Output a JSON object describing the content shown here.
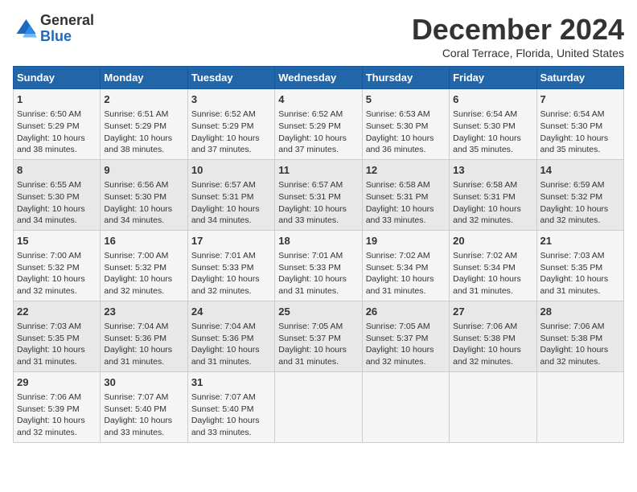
{
  "header": {
    "logo_line1": "General",
    "logo_line2": "Blue",
    "title": "December 2024",
    "subtitle": "Coral Terrace, Florida, United States"
  },
  "days_of_week": [
    "Sunday",
    "Monday",
    "Tuesday",
    "Wednesday",
    "Thursday",
    "Friday",
    "Saturday"
  ],
  "weeks": [
    [
      {
        "day": 1,
        "info": "Sunrise: 6:50 AM\nSunset: 5:29 PM\nDaylight: 10 hours\nand 38 minutes."
      },
      {
        "day": 2,
        "info": "Sunrise: 6:51 AM\nSunset: 5:29 PM\nDaylight: 10 hours\nand 38 minutes."
      },
      {
        "day": 3,
        "info": "Sunrise: 6:52 AM\nSunset: 5:29 PM\nDaylight: 10 hours\nand 37 minutes."
      },
      {
        "day": 4,
        "info": "Sunrise: 6:52 AM\nSunset: 5:29 PM\nDaylight: 10 hours\nand 37 minutes."
      },
      {
        "day": 5,
        "info": "Sunrise: 6:53 AM\nSunset: 5:30 PM\nDaylight: 10 hours\nand 36 minutes."
      },
      {
        "day": 6,
        "info": "Sunrise: 6:54 AM\nSunset: 5:30 PM\nDaylight: 10 hours\nand 35 minutes."
      },
      {
        "day": 7,
        "info": "Sunrise: 6:54 AM\nSunset: 5:30 PM\nDaylight: 10 hours\nand 35 minutes."
      }
    ],
    [
      {
        "day": 8,
        "info": "Sunrise: 6:55 AM\nSunset: 5:30 PM\nDaylight: 10 hours\nand 34 minutes."
      },
      {
        "day": 9,
        "info": "Sunrise: 6:56 AM\nSunset: 5:30 PM\nDaylight: 10 hours\nand 34 minutes."
      },
      {
        "day": 10,
        "info": "Sunrise: 6:57 AM\nSunset: 5:31 PM\nDaylight: 10 hours\nand 34 minutes."
      },
      {
        "day": 11,
        "info": "Sunrise: 6:57 AM\nSunset: 5:31 PM\nDaylight: 10 hours\nand 33 minutes."
      },
      {
        "day": 12,
        "info": "Sunrise: 6:58 AM\nSunset: 5:31 PM\nDaylight: 10 hours\nand 33 minutes."
      },
      {
        "day": 13,
        "info": "Sunrise: 6:58 AM\nSunset: 5:31 PM\nDaylight: 10 hours\nand 32 minutes."
      },
      {
        "day": 14,
        "info": "Sunrise: 6:59 AM\nSunset: 5:32 PM\nDaylight: 10 hours\nand 32 minutes."
      }
    ],
    [
      {
        "day": 15,
        "info": "Sunrise: 7:00 AM\nSunset: 5:32 PM\nDaylight: 10 hours\nand 32 minutes."
      },
      {
        "day": 16,
        "info": "Sunrise: 7:00 AM\nSunset: 5:32 PM\nDaylight: 10 hours\nand 32 minutes."
      },
      {
        "day": 17,
        "info": "Sunrise: 7:01 AM\nSunset: 5:33 PM\nDaylight: 10 hours\nand 32 minutes."
      },
      {
        "day": 18,
        "info": "Sunrise: 7:01 AM\nSunset: 5:33 PM\nDaylight: 10 hours\nand 31 minutes."
      },
      {
        "day": 19,
        "info": "Sunrise: 7:02 AM\nSunset: 5:34 PM\nDaylight: 10 hours\nand 31 minutes."
      },
      {
        "day": 20,
        "info": "Sunrise: 7:02 AM\nSunset: 5:34 PM\nDaylight: 10 hours\nand 31 minutes."
      },
      {
        "day": 21,
        "info": "Sunrise: 7:03 AM\nSunset: 5:35 PM\nDaylight: 10 hours\nand 31 minutes."
      }
    ],
    [
      {
        "day": 22,
        "info": "Sunrise: 7:03 AM\nSunset: 5:35 PM\nDaylight: 10 hours\nand 31 minutes."
      },
      {
        "day": 23,
        "info": "Sunrise: 7:04 AM\nSunset: 5:36 PM\nDaylight: 10 hours\nand 31 minutes."
      },
      {
        "day": 24,
        "info": "Sunrise: 7:04 AM\nSunset: 5:36 PM\nDaylight: 10 hours\nand 31 minutes."
      },
      {
        "day": 25,
        "info": "Sunrise: 7:05 AM\nSunset: 5:37 PM\nDaylight: 10 hours\nand 31 minutes."
      },
      {
        "day": 26,
        "info": "Sunrise: 7:05 AM\nSunset: 5:37 PM\nDaylight: 10 hours\nand 32 minutes."
      },
      {
        "day": 27,
        "info": "Sunrise: 7:06 AM\nSunset: 5:38 PM\nDaylight: 10 hours\nand 32 minutes."
      },
      {
        "day": 28,
        "info": "Sunrise: 7:06 AM\nSunset: 5:38 PM\nDaylight: 10 hours\nand 32 minutes."
      }
    ],
    [
      {
        "day": 29,
        "info": "Sunrise: 7:06 AM\nSunset: 5:39 PM\nDaylight: 10 hours\nand 32 minutes."
      },
      {
        "day": 30,
        "info": "Sunrise: 7:07 AM\nSunset: 5:40 PM\nDaylight: 10 hours\nand 33 minutes."
      },
      {
        "day": 31,
        "info": "Sunrise: 7:07 AM\nSunset: 5:40 PM\nDaylight: 10 hours\nand 33 minutes."
      },
      null,
      null,
      null,
      null
    ]
  ]
}
